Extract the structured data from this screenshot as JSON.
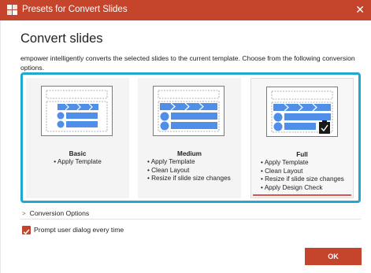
{
  "window": {
    "title": "Presets for Convert Slides",
    "close_icon": "close-icon",
    "app_icon": "empower-logo-icon",
    "accent_color": "#c4452c",
    "selection_color": "#21a8cf"
  },
  "dialog": {
    "heading": "Convert slides",
    "description": "empower intelligently converts the selected slides to the current template. Choose from the following conversion options."
  },
  "presets": [
    {
      "title": "Basic",
      "items": [
        "• Apply Template"
      ],
      "selected": false
    },
    {
      "title": "Medium",
      "items": [
        "• Apply Template",
        "• Clean Layout",
        "• Resize if slide size changes"
      ],
      "selected": false
    },
    {
      "title": "Full",
      "items": [
        "• Apply Template",
        "• Clean Layout",
        "• Resize if slide size changes",
        "• Apply Design Check"
      ],
      "selected": true
    }
  ],
  "conversion_options": {
    "label": "Conversion Options",
    "icon": "chevron-right-icon"
  },
  "prompt_checkbox": {
    "label": "Prompt user dialog every time",
    "checked": true
  },
  "ok_button": {
    "label": "OK"
  }
}
